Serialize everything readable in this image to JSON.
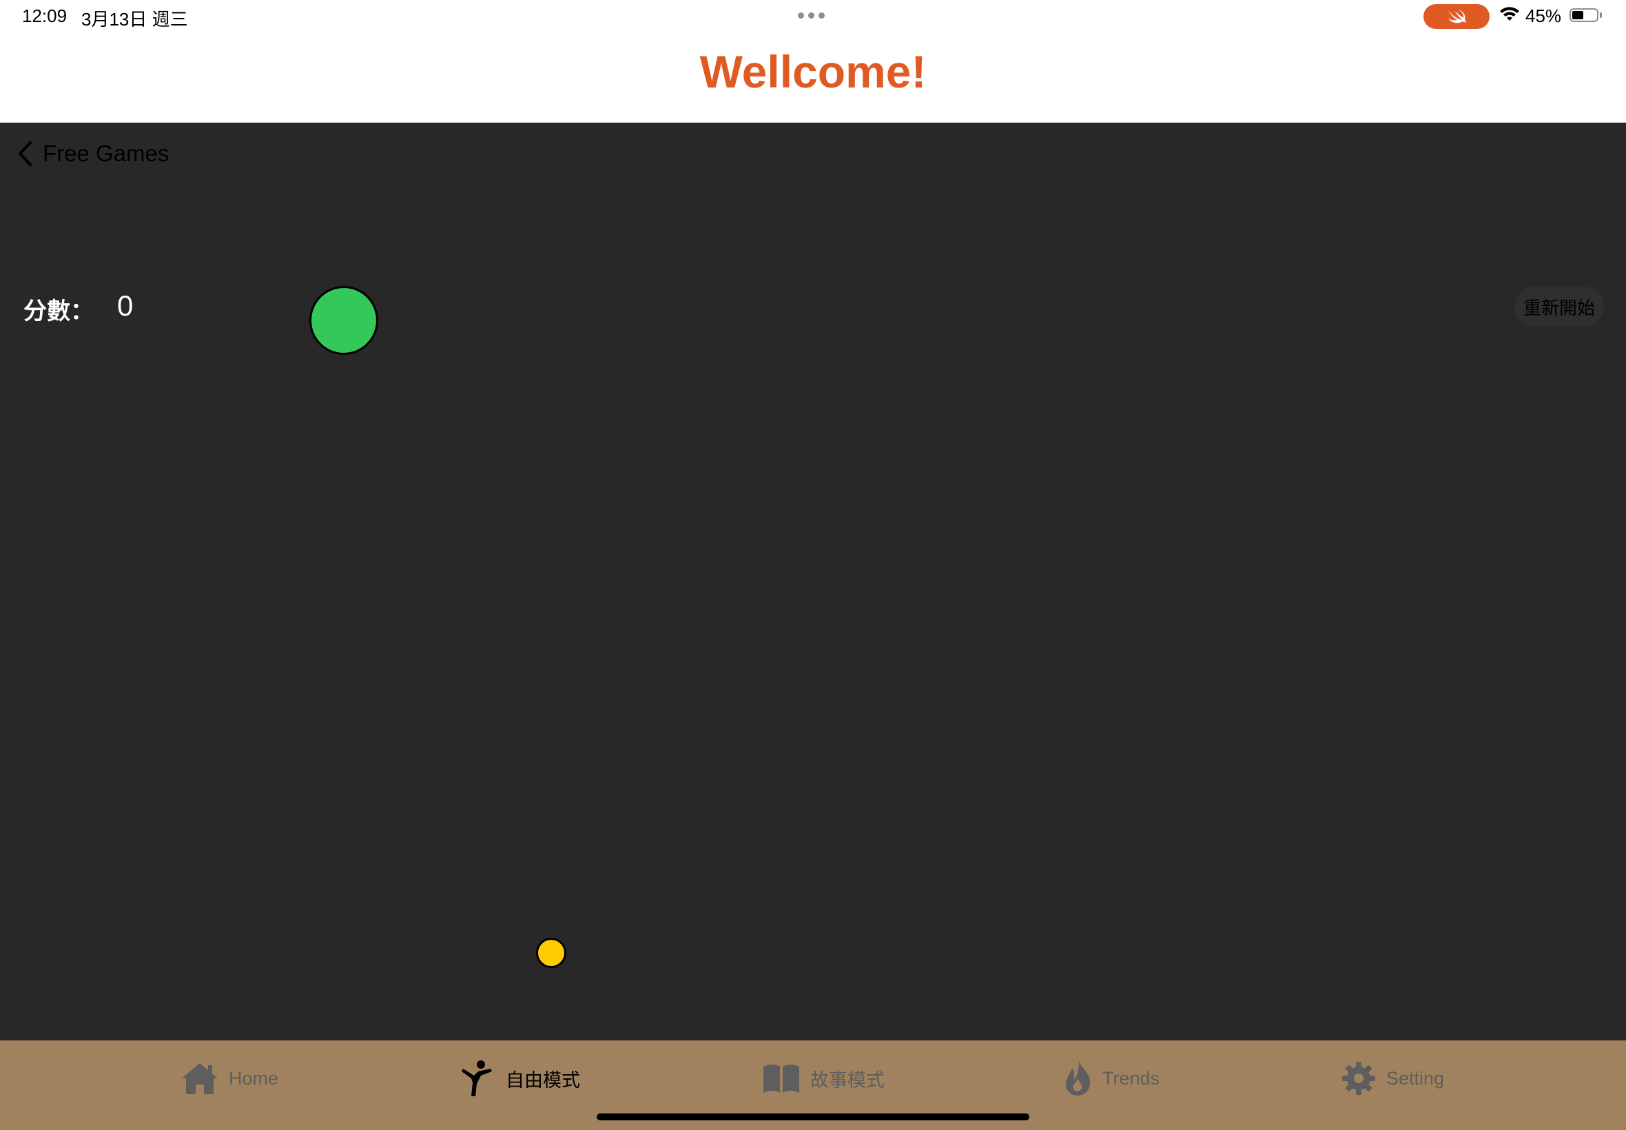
{
  "status_bar": {
    "time": "12:09",
    "date": "3月13日 週三",
    "battery": "45%"
  },
  "header": {
    "title": "Wellcome!",
    "title_color": "#e05a24"
  },
  "nav": {
    "back_label": "Free Games"
  },
  "game": {
    "score_label": "分數：",
    "score_value": "0",
    "restart_label": "重新開始",
    "background": "#282828",
    "player_ball_color": "#34c759",
    "target_ball_color": "#ffcc00"
  },
  "tabbar": {
    "background": "#a0835e",
    "tabs": [
      {
        "label": "Home",
        "icon": "house-icon",
        "active": false
      },
      {
        "label": "自由模式",
        "icon": "kick-figure-icon",
        "active": true
      },
      {
        "label": "故事模式",
        "icon": "book-icon",
        "active": false
      },
      {
        "label": "Trends",
        "icon": "flame-icon",
        "active": false
      },
      {
        "label": "Setting",
        "icon": "gear-icon",
        "active": false
      }
    ]
  }
}
